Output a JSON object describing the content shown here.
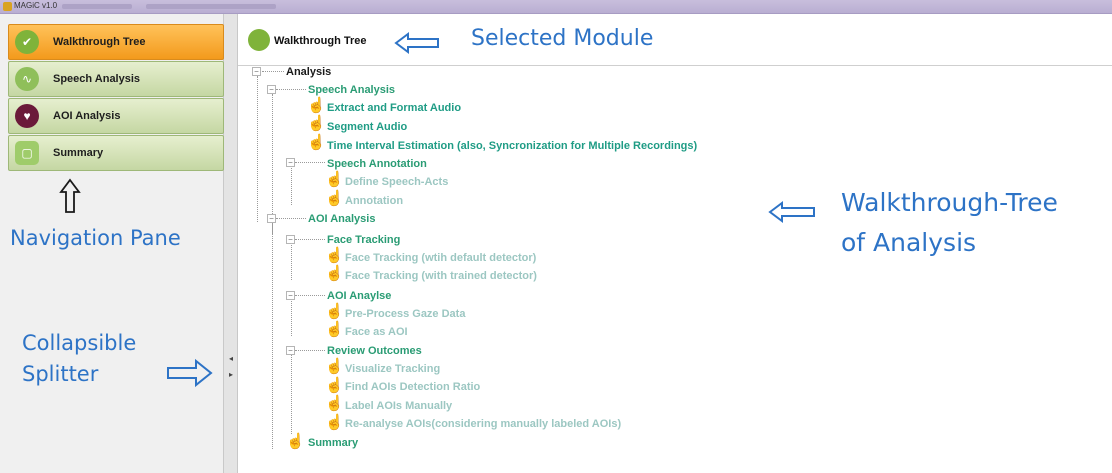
{
  "window": {
    "title": "MAGiC v1.0"
  },
  "nav": {
    "items": [
      {
        "label": "Walkthrough Tree",
        "icon": "walkthrough-icon",
        "active": true
      },
      {
        "label": "Speech Analysis",
        "icon": "waveform-icon",
        "active": false
      },
      {
        "label": "AOI Analysis",
        "icon": "heart-icon",
        "active": false
      },
      {
        "label": "Summary",
        "icon": "summary-icon",
        "active": false
      }
    ]
  },
  "header": {
    "title": "Walkthrough Tree"
  },
  "tree": {
    "root": "Analysis",
    "speech": "Speech Analysis",
    "extract": "Extract and Format Audio",
    "segment": "Segment Audio",
    "time": "Time Interval Estimation (also, Syncronization for Multiple Recordings)",
    "annotation_group": "Speech Annotation",
    "define": "Define Speech-Acts",
    "annotation": "Annotation",
    "aoi": "AOI Analysis",
    "face_tracking": "Face Tracking",
    "ft_default": "Face Tracking (wtih default detector)",
    "ft_trained": "Face Tracking (with trained detector)",
    "aoi_analyse": "AOI Anaylse",
    "preprocess": "Pre-Process Gaze Data",
    "face_aoi": "Face as AOI",
    "review": "Review Outcomes",
    "visualize": "Visualize Tracking",
    "find": "Find AOIs Detection Ratio",
    "label": "Label AOIs Manually",
    "reanalyse": "Re-analyse AOIs(considering manually labeled AOIs)",
    "summary": "Summary"
  },
  "annotations": {
    "selected_module": "Selected Module",
    "navigation_pane": "Navigation Pane",
    "collapsible": "Collapsible",
    "splitter": "Splitter",
    "walkthrough_tree": "Walkthrough-Tree",
    "of_analysis": "of Analysis"
  },
  "colors": {
    "active": "#f5a024",
    "inactive": "#cfe0b0",
    "annotation": "#2d73c6"
  }
}
